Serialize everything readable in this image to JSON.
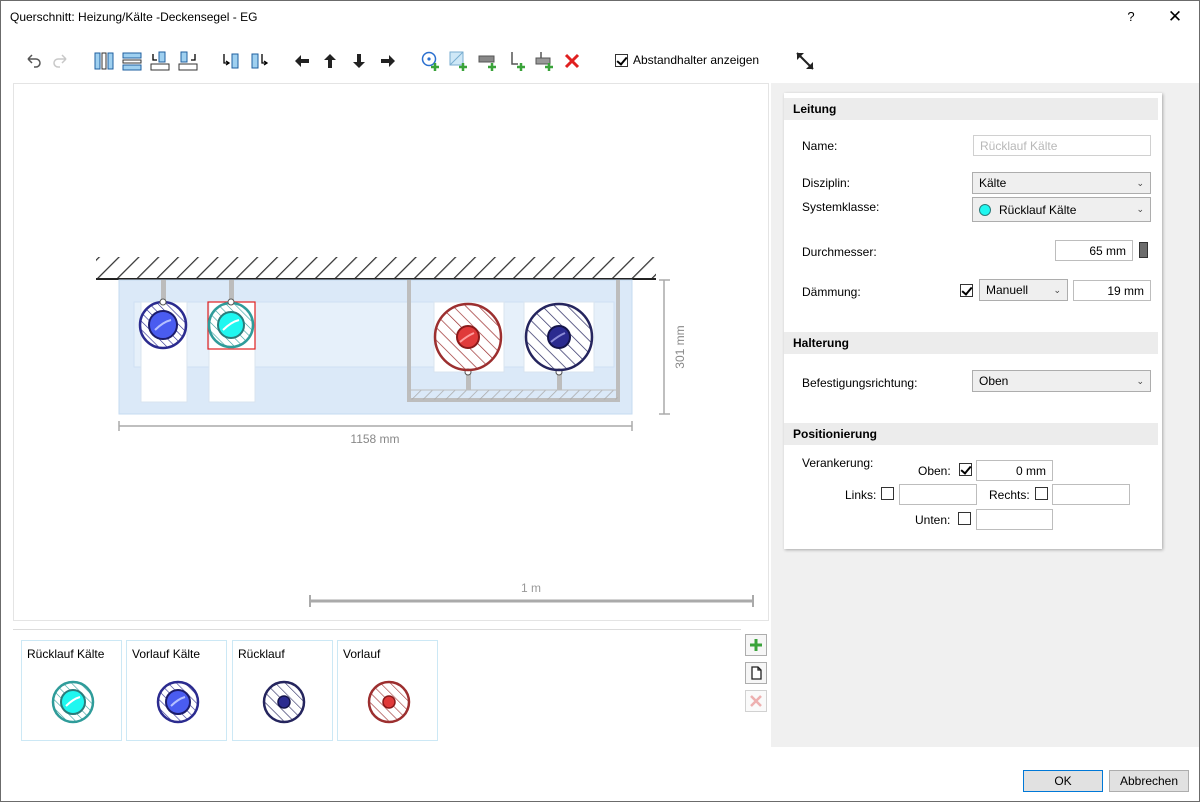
{
  "window": {
    "title": "Querschnitt: Heizung/Kälte -Deckensegel - EG",
    "help": "?",
    "close": "✕"
  },
  "toolbar": {
    "show_spacers_label": "Abstandhalter anzeigen",
    "show_spacers_checked": true
  },
  "canvas": {
    "dim_height": "301 mm",
    "dim_width": "1158 mm",
    "scale_label": "1 m"
  },
  "properties": {
    "leitung": {
      "header": "Leitung",
      "name_label": "Name:",
      "name_value": "Rücklauf Kälte",
      "disziplin_label": "Disziplin:",
      "disziplin_value": "Kälte",
      "systemklasse_label": "Systemklasse:",
      "systemklasse_value": "Rücklauf Kälte",
      "systemklasse_color": "#1ff7f0",
      "durchmesser_label": "Durchmesser:",
      "durchmesser_value": "65 mm",
      "daemmung_label": "Dämmung:",
      "daemmung_checked": true,
      "daemmung_mode": "Manuell",
      "daemmung_value": "19 mm"
    },
    "halterung": {
      "header": "Halterung",
      "befestigung_label": "Befestigungsrichtung:",
      "befestigung_value": "Oben"
    },
    "positionierung": {
      "header": "Positionierung",
      "verankerung_label": "Verankerung:",
      "oben_label": "Oben:",
      "oben_checked": true,
      "oben_value": "0 mm",
      "links_label": "Links:",
      "links_checked": false,
      "links_value": "",
      "rechts_label": "Rechts:",
      "rechts_checked": false,
      "rechts_value": "",
      "unten_label": "Unten:",
      "unten_checked": false,
      "unten_value": ""
    }
  },
  "palette": {
    "items": [
      {
        "name": "Rücklauf Kälte",
        "color": "#2f9c9a",
        "fill": "#1ff7f0"
      },
      {
        "name": "Vorlauf Kälte",
        "color": "#2b2b8f",
        "fill": "#4a5cf0"
      },
      {
        "name": "Rücklauf",
        "color": "#25255e",
        "fill": "#25255e"
      },
      {
        "name": "Vorlauf",
        "color": "#9c2f2f",
        "fill": "#b32020"
      }
    ]
  },
  "footer": {
    "ok_label": "OK",
    "cancel_label": "Abbrechen"
  }
}
